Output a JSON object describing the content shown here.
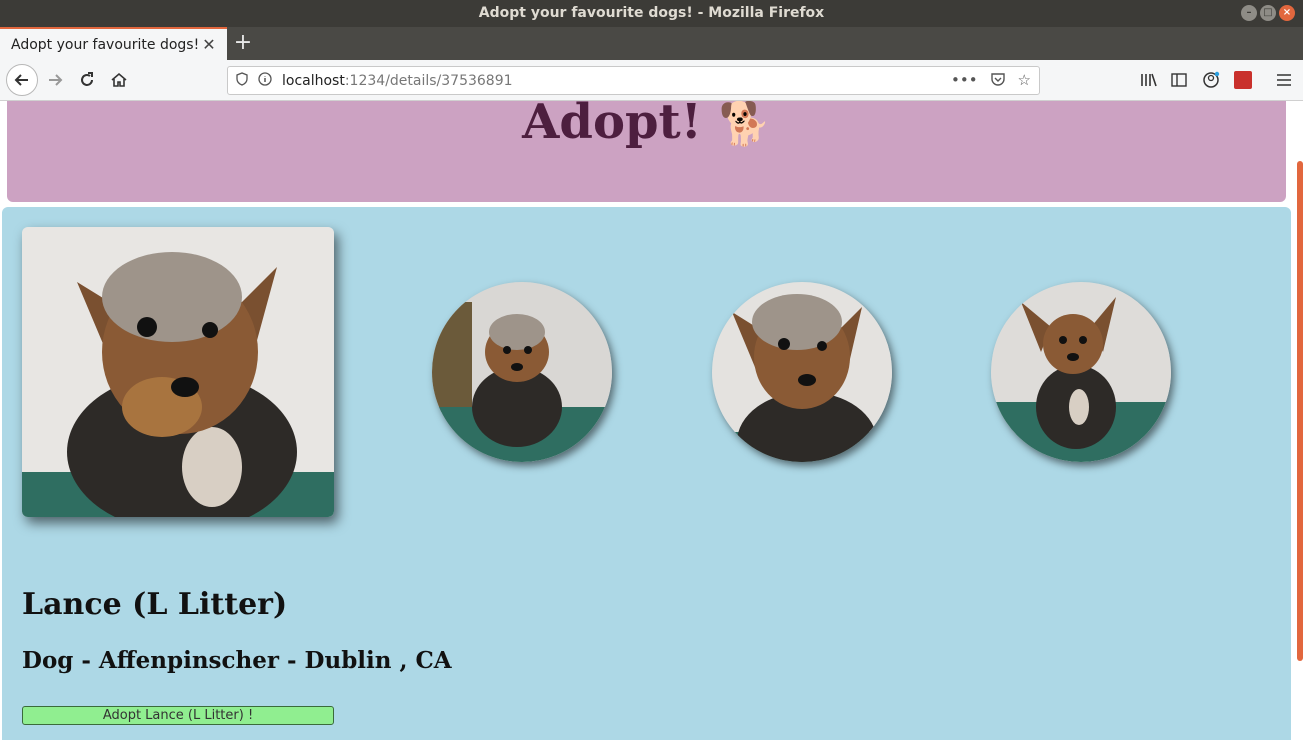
{
  "window": {
    "title": "Adopt your favourite dogs! - Mozilla Firefox"
  },
  "tab": {
    "title": "Adopt your favourite dogs!"
  },
  "urlbar": {
    "host": "localhost",
    "path": ":1234/details/37536891"
  },
  "header": {
    "title": "Adopt!",
    "emoji": "🐕"
  },
  "pet": {
    "name": "Lance (L Litter)",
    "subtitle": "Dog - Affenpinscher - Dublin , CA",
    "adopt_button": "Adopt Lance (L Litter) !"
  },
  "colors": {
    "header_bg": "#cca2c2",
    "header_text": "#4d1f3f",
    "details_bg": "#add8e6",
    "adopt_button_bg": "#90ee90",
    "tab_accent": "#e2673e"
  }
}
